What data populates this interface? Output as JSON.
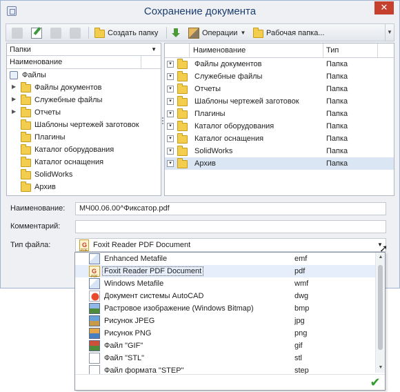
{
  "window": {
    "title": "Сохранение документа",
    "close_label": "✕"
  },
  "toolbar": {
    "create_folder_label": "Создать папку",
    "operations_label": "Операции",
    "work_folder_label": "Рабочая папка..."
  },
  "left_panel": {
    "selector_label": "Папки",
    "column_header": "Наименование",
    "root_label": "Файлы",
    "items": [
      {
        "label": "Файлы документов",
        "expandable": true
      },
      {
        "label": "Служебные файлы",
        "expandable": true
      },
      {
        "label": "Отчеты",
        "expandable": true
      },
      {
        "label": "Шаблоны чертежей заготовок",
        "expandable": false
      },
      {
        "label": "Плагины",
        "expandable": false
      },
      {
        "label": "Каталог оборудования",
        "expandable": false
      },
      {
        "label": "Каталог оснащения",
        "expandable": false
      },
      {
        "label": "SolidWorks",
        "expandable": false
      },
      {
        "label": "Архив",
        "expandable": false
      }
    ]
  },
  "right_panel": {
    "col_name": "Наименование",
    "col_type": "Тип",
    "rows": [
      {
        "name": "Файлы документов",
        "type": "Папка"
      },
      {
        "name": "Служебные файлы",
        "type": "Папка"
      },
      {
        "name": "Отчеты",
        "type": "Папка"
      },
      {
        "name": "Шаблоны чертежей заготовок",
        "type": "Папка"
      },
      {
        "name": "Плагины",
        "type": "Папка"
      },
      {
        "name": "Каталог оборудования",
        "type": "Папка"
      },
      {
        "name": "Каталог оснащения",
        "type": "Папка"
      },
      {
        "name": "SolidWorks",
        "type": "Папка"
      },
      {
        "name": "Архив",
        "type": "Папка",
        "selected": true
      }
    ]
  },
  "form": {
    "name_label": "Наименование:",
    "name_value": "МЧ00.06.00^Фиксатор.pdf",
    "comment_label": "Комментарий:",
    "comment_value": "",
    "filetype_label": "Тип файла:",
    "filetype_value": "Foxit Reader PDF Document"
  },
  "filetype_options": [
    {
      "name": "Enhanced Metafile",
      "ext": "emf",
      "icon": "metafile-icon"
    },
    {
      "name": "Foxit Reader PDF Document",
      "ext": "pdf",
      "icon": "pdf-icon",
      "selected": true
    },
    {
      "name": "Windows Metafile",
      "ext": "wmf",
      "icon": "metafile-icon"
    },
    {
      "name": "Документ системы AutoCAD",
      "ext": "dwg",
      "icon": "autocad-icon"
    },
    {
      "name": "Растровое изображение (Windows Bitmap)",
      "ext": "bmp",
      "icon": "bitmap-icon"
    },
    {
      "name": "Рисунок JPEG",
      "ext": "jpg",
      "icon": "jpeg-icon"
    },
    {
      "name": "Рисунок PNG",
      "ext": "png",
      "icon": "png-icon"
    },
    {
      "name": "Файл \"GIF\"",
      "ext": "gif",
      "icon": "gif-icon"
    },
    {
      "name": "Файл \"STL\"",
      "ext": "stl",
      "icon": "document-icon"
    },
    {
      "name": "Файл формата \"STEP\"",
      "ext": "step",
      "icon": "document-icon"
    }
  ],
  "colors": {
    "title_text": "#1b3d6e",
    "close_button": "#c6402e",
    "selection": "#dbe6f4",
    "folder": "#f3ce4e",
    "confirm": "#2e9d2a"
  }
}
